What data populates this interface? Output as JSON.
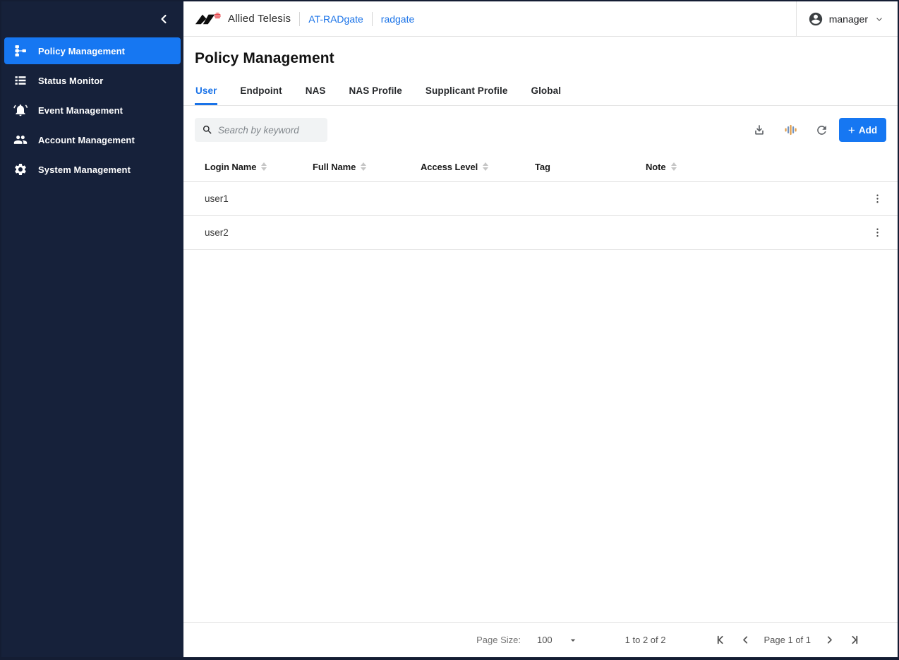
{
  "sidebar": {
    "items": [
      {
        "label": "Policy Management",
        "icon": "schema-icon",
        "active": true
      },
      {
        "label": "Status Monitor",
        "icon": "list-icon",
        "active": false
      },
      {
        "label": "Event Management",
        "icon": "bell-icon",
        "active": false
      },
      {
        "label": "Account Management",
        "icon": "people-icon",
        "active": false
      },
      {
        "label": "System Management",
        "icon": "gear-icon",
        "active": false
      }
    ]
  },
  "header": {
    "brand": "Allied Telesis",
    "product_link": "AT-RADgate",
    "host_link": "radgate",
    "user_name": "manager"
  },
  "page": {
    "title": "Policy Management"
  },
  "tabs": {
    "active": "User",
    "items": [
      {
        "label": "User"
      },
      {
        "label": "Endpoint"
      },
      {
        "label": "NAS"
      },
      {
        "label": "NAS Profile"
      },
      {
        "label": "Supplicant Profile"
      },
      {
        "label": "Global"
      }
    ]
  },
  "toolbar": {
    "search_placeholder": "Search by keyword",
    "add_icon": "+",
    "add_label": "Add",
    "icons": [
      "download-icon",
      "filter-columns-icon",
      "refresh-icon"
    ]
  },
  "table": {
    "columns": [
      {
        "label": "Login Name",
        "sortable": true
      },
      {
        "label": "Full Name",
        "sortable": true
      },
      {
        "label": "Access Level",
        "sortable": true
      },
      {
        "label": "Tag",
        "sortable": false
      },
      {
        "label": "Note",
        "sortable": true
      }
    ],
    "rows": [
      {
        "login_name": "user1",
        "full_name": "",
        "access_level": "",
        "tag": "",
        "note": ""
      },
      {
        "login_name": "user2",
        "full_name": "",
        "access_level": "",
        "tag": "",
        "note": ""
      }
    ]
  },
  "footer": {
    "page_size_label": "Page Size:",
    "page_size_value": "100",
    "range_text": "1 to 2 of 2",
    "page_text": "Page 1 of 1"
  },
  "colors": {
    "sidebar_bg": "#16213a",
    "accent_blue": "#1677f2",
    "link_blue": "#1a73e8",
    "logo_red": "#e3242b",
    "border_gray": "#e0e0e0",
    "search_bg": "#f1f3f4"
  }
}
